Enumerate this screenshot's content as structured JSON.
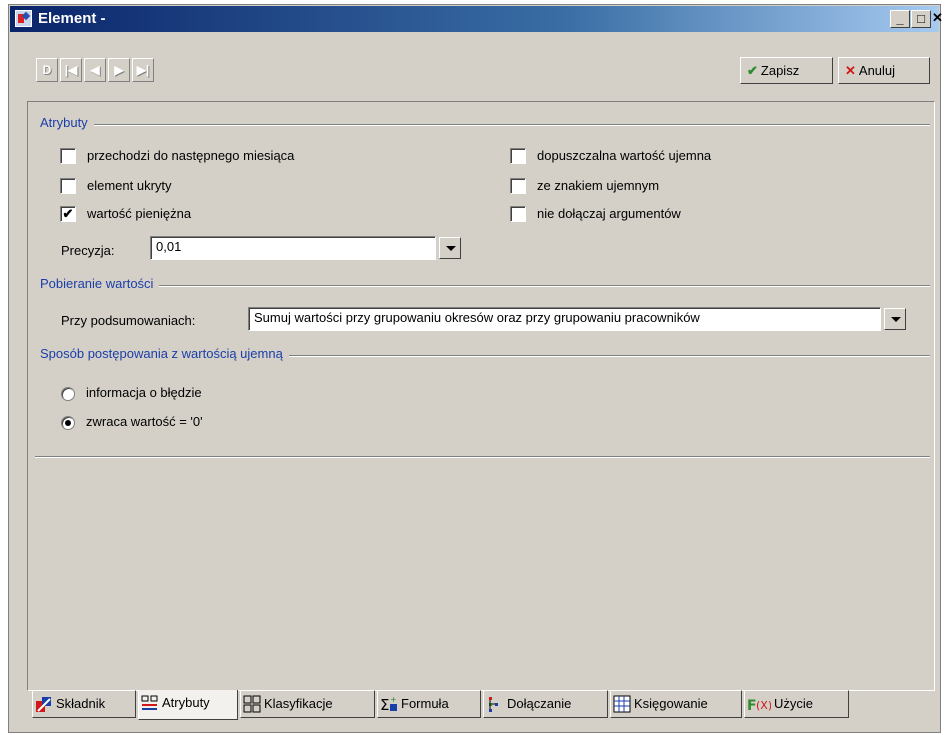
{
  "window": {
    "title": "Element -"
  },
  "toolbar": {
    "nav": [
      "D",
      "|◀",
      "◀",
      "▶",
      "▶|"
    ],
    "save_label": "Zapisz",
    "cancel_label": "Anuluj"
  },
  "attrs": {
    "group_label": "Atrybuty",
    "checkboxes_left": [
      {
        "label": "przechodzi do następnego miesiąca",
        "checked": false
      },
      {
        "label": "element ukryty",
        "checked": false
      },
      {
        "label": "wartość pieniężna",
        "checked": true
      }
    ],
    "checkboxes_right": [
      {
        "label": "dopuszczalna wartość ujemna",
        "checked": false
      },
      {
        "label": "ze znakiem ujemnym",
        "checked": false
      },
      {
        "label": "nie dołączaj argumentów",
        "checked": false
      }
    ],
    "precision_label": "Precyzja:",
    "precision_value": "0,01"
  },
  "fetch": {
    "group_label": "Pobieranie wartości",
    "summary_label": "Przy podsumowaniach:",
    "summary_value": "Sumuj wartości przy grupowaniu okresów oraz przy grupowaniu pracowników"
  },
  "negative": {
    "group_label": "Sposób postępowania z wartością ujemną",
    "options": [
      {
        "label": "informacja o błędzie",
        "selected": false
      },
      {
        "label": "zwraca wartość = '0'",
        "selected": true
      }
    ]
  },
  "tabs": [
    {
      "label": "Składnik",
      "icon": "component-icon",
      "active": false
    },
    {
      "label": "Atrybuty",
      "icon": "attributes-icon",
      "active": true
    },
    {
      "label": "Klasyfikacje",
      "icon": "classification-icon",
      "active": false
    },
    {
      "label": "Formuła",
      "icon": "formula-icon",
      "active": false
    },
    {
      "label": "Dołączanie",
      "icon": "attach-icon",
      "active": false
    },
    {
      "label": "Księgowanie",
      "icon": "accounting-icon",
      "active": false
    },
    {
      "label": "Użycie",
      "icon": "function-icon",
      "active": false
    }
  ],
  "colors": {
    "group_label": "#1a3ea8",
    "save_check": "#2e8b2e",
    "cancel_x": "#d01818"
  }
}
